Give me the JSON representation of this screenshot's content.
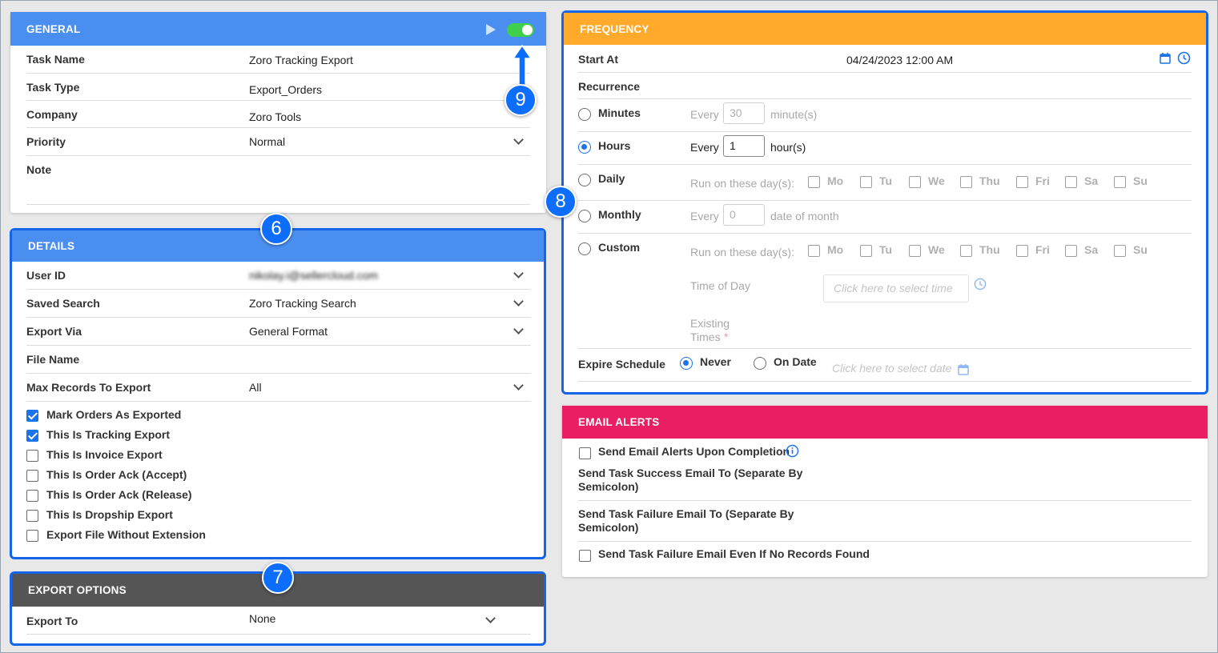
{
  "colors": {
    "general_header": "#4a8ff0",
    "details_header": "#4a8ff0",
    "export_options_header": "#555555",
    "frequency_header": "#ffaa2a",
    "email_alerts_header": "#e91e63",
    "toggle_on": "#3fcf4a",
    "checkbox_accent": "#1a73e8",
    "callout": "#0d6efd"
  },
  "general": {
    "header": "GENERAL",
    "rows": [
      {
        "label": "Task Name",
        "value": "Zoro Tracking Export"
      },
      {
        "label": "Task Type",
        "value": "Export_Orders"
      },
      {
        "label": "Company",
        "value": "Zoro Tools"
      },
      {
        "label": "Priority",
        "value": "Normal"
      },
      {
        "label": "Note",
        "value": ""
      }
    ]
  },
  "details": {
    "header": "DETAILS",
    "rows": [
      {
        "label": "User ID",
        "value": "nikolay.i@sellercloud.com"
      },
      {
        "label": "Saved Search",
        "value": "Zoro Tracking Search"
      },
      {
        "label": "Export Via",
        "value": "General Format"
      },
      {
        "label": "File Name",
        "value": ""
      },
      {
        "label": "Max Records To Export",
        "value": "All"
      }
    ],
    "checkboxes": [
      {
        "label": "Mark Orders As Exported",
        "checked": true
      },
      {
        "label": "This Is Tracking Export",
        "checked": true
      },
      {
        "label": "This Is Invoice Export",
        "checked": false
      },
      {
        "label": "This Is Order Ack (Accept)",
        "checked": false
      },
      {
        "label": "This Is Order Ack (Release)",
        "checked": false
      },
      {
        "label": "This Is Dropship Export",
        "checked": false
      },
      {
        "label": "Export File Without Extension",
        "checked": false
      }
    ]
  },
  "export_options": {
    "header": "EXPORT OPTIONS",
    "export_to_label": "Export To",
    "export_to_value": "None"
  },
  "frequency": {
    "header": "FREQUENCY",
    "start_at_label": "Start At",
    "start_at_value": "04/24/2023 12:00 AM",
    "recurrence_label": "Recurrence",
    "every": "Every",
    "minutes": {
      "label": "Minutes",
      "value": "30",
      "unit": "minute(s)"
    },
    "hours": {
      "label": "Hours",
      "value": "1",
      "unit": "hour(s)"
    },
    "daily": {
      "label": "Daily",
      "run_label": "Run on these day(s):"
    },
    "monthly": {
      "label": "Monthly",
      "value": "0",
      "unit": "date of month"
    },
    "custom": {
      "label": "Custom",
      "run_label": "Run on these day(s):",
      "time_of_day_label": "Time of Day",
      "time_placeholder": "Click here to select time",
      "existing_times_label": "Existing",
      "existing_times_label2": "Times",
      "required_mark": "*"
    },
    "days": [
      "Mo",
      "Tu",
      "We",
      "Thu",
      "Fri",
      "Sa",
      "Su"
    ],
    "expire_label": "Expire Schedule",
    "never_label": "Never",
    "on_date_label": "On Date",
    "date_placeholder": "Click here to select date"
  },
  "email_alerts": {
    "header": "EMAIL ALERTS",
    "send_upon_completion": "Send Email Alerts Upon Completion",
    "success_label_1": "Send Task Success Email To (Separate By",
    "success_label_2": "Semicolon)",
    "failure_label_1": "Send Task Failure Email To (Separate By",
    "failure_label_2": "Semicolon)",
    "failure_no_records": "Send Task Failure Email Even If No Records Found"
  },
  "callouts": {
    "six": "6",
    "seven": "7",
    "eight": "8",
    "nine": "9"
  }
}
